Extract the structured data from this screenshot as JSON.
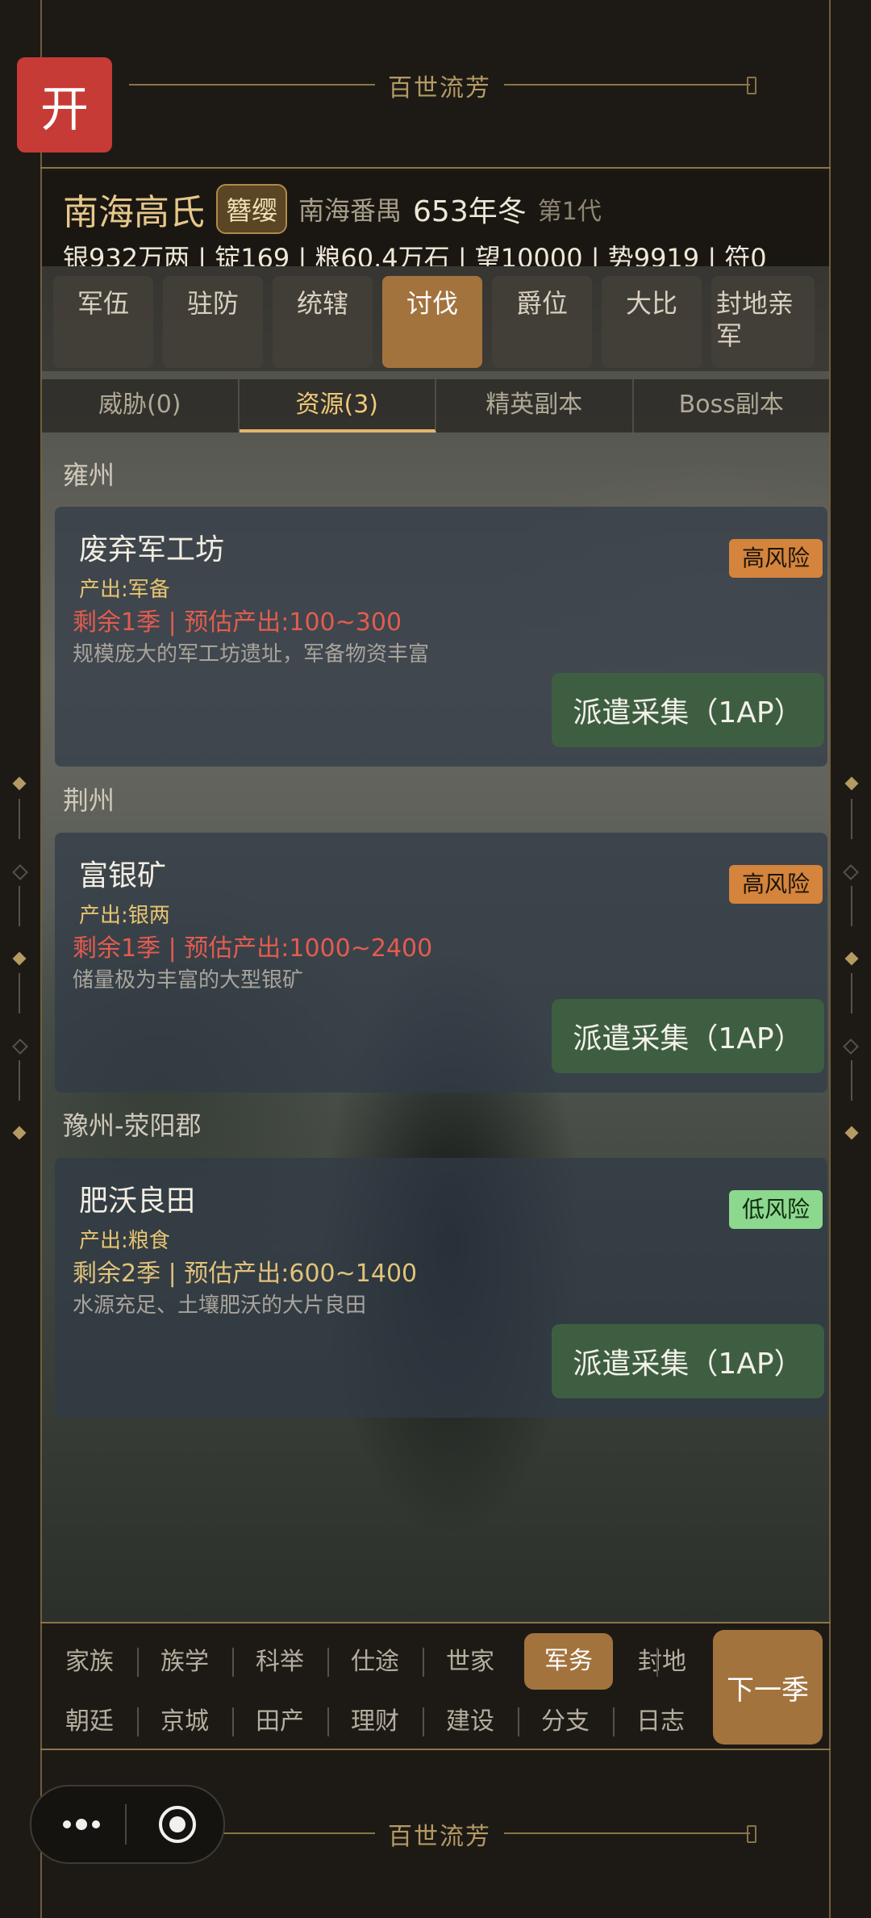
{
  "banner": {
    "title": "百世流芳"
  },
  "open_button": {
    "label": "开"
  },
  "clan": {
    "name": "南海高氏",
    "badge": "簪缨",
    "place": "南海番禺",
    "year": "653年冬",
    "generation": "第1代",
    "resources": "银932万两 | 锭169 | 粮60.4万石 | 望10000 | 势9919 | 符0"
  },
  "tabs": [
    "军伍",
    "驻防",
    "统辖",
    "讨伐",
    "爵位",
    "大比",
    "封地亲军"
  ],
  "active_tab": "讨伐",
  "subtabs": [
    "威胁(0)",
    "资源(3)",
    "精英副本",
    "Boss副本"
  ],
  "active_subtab": "资源(3)",
  "resources": [
    {
      "region": "雍州",
      "name": "废弃军工坊",
      "output": "产出:军备",
      "remain": "剩余1季 | 预估产出:100~300",
      "desc": "规模庞大的军工坊遗址，军备物资丰富",
      "risk": "高风险",
      "button": "派遣采集（1AP）"
    },
    {
      "region": "荆州",
      "name": "富银矿",
      "output": "产出:银两",
      "remain": "剩余1季 | 预估产出:1000~2400",
      "desc": "储量极为丰富的大型银矿",
      "risk": "高风险",
      "button": "派遣采集（1AP）"
    },
    {
      "region": "豫州-荥阳郡",
      "name": "肥沃良田",
      "output": "产出:粮食",
      "remain": "剩余2季 | 预估产出:600~1400",
      "desc": "水源充足、土壤肥沃的大片良田",
      "risk": "低风险",
      "button": "派遣采集（1AP）"
    }
  ],
  "bottom_nav": {
    "row1": [
      "家族",
      "族学",
      "科举",
      "仕途",
      "世家",
      "军务",
      "封地"
    ],
    "row2": [
      "朝廷",
      "京城",
      "田产",
      "理财",
      "建设",
      "分支",
      "日志"
    ],
    "active": "军务",
    "next_season": "下一季"
  },
  "colors": {
    "accent": "#a3733e",
    "high_risk": "#d4843c",
    "low_risk": "#8cd88e",
    "dispatch": "#3e5e42",
    "open": "#c63b36"
  }
}
